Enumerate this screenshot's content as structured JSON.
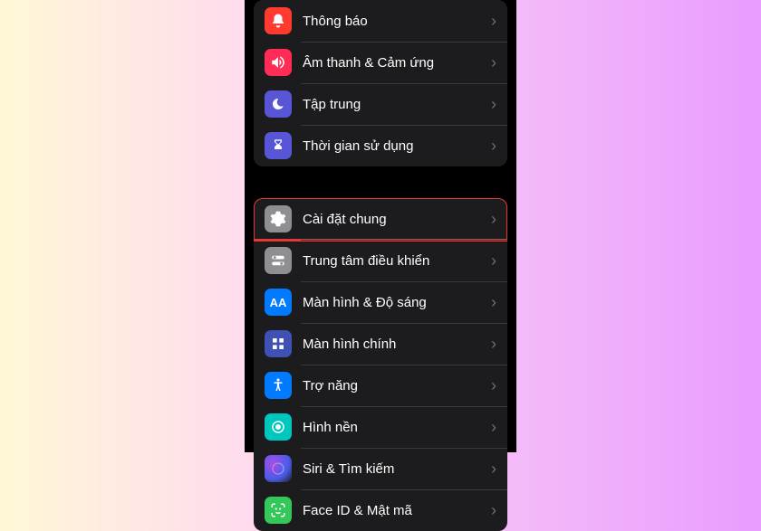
{
  "group1": {
    "items": [
      {
        "label": "Thông báo",
        "icon": "bell-icon",
        "color": "#ff3b30"
      },
      {
        "label": "Âm thanh & Cảm ứng",
        "icon": "speaker-icon",
        "color": "#ff2d55"
      },
      {
        "label": "Tập trung",
        "icon": "moon-icon",
        "color": "#5856d6"
      },
      {
        "label": "Thời gian sử dụng",
        "icon": "hourglass-icon",
        "color": "#5856d6"
      }
    ]
  },
  "group2": {
    "items": [
      {
        "label": "Cài đặt chung",
        "icon": "gear-icon",
        "color": "#8e8e93",
        "highlighted": true
      },
      {
        "label": "Trung tâm điều khiển",
        "icon": "switches-icon",
        "color": "#8e8e93"
      },
      {
        "label": "Màn hình & Độ sáng",
        "icon": "text-size-icon",
        "color": "#007aff"
      },
      {
        "label": "Màn hình chính",
        "icon": "grid-icon",
        "color": "#3f51b5"
      },
      {
        "label": "Trợ năng",
        "icon": "accessibility-icon",
        "color": "#007aff"
      },
      {
        "label": "Hình nền",
        "icon": "wallpaper-icon",
        "color": "#00c7be"
      },
      {
        "label": "Siri & Tìm kiếm",
        "icon": "siri-icon",
        "color": "#1c1c1e"
      },
      {
        "label": "Face ID & Mật mã",
        "icon": "faceid-icon",
        "color": "#34c759"
      }
    ]
  }
}
